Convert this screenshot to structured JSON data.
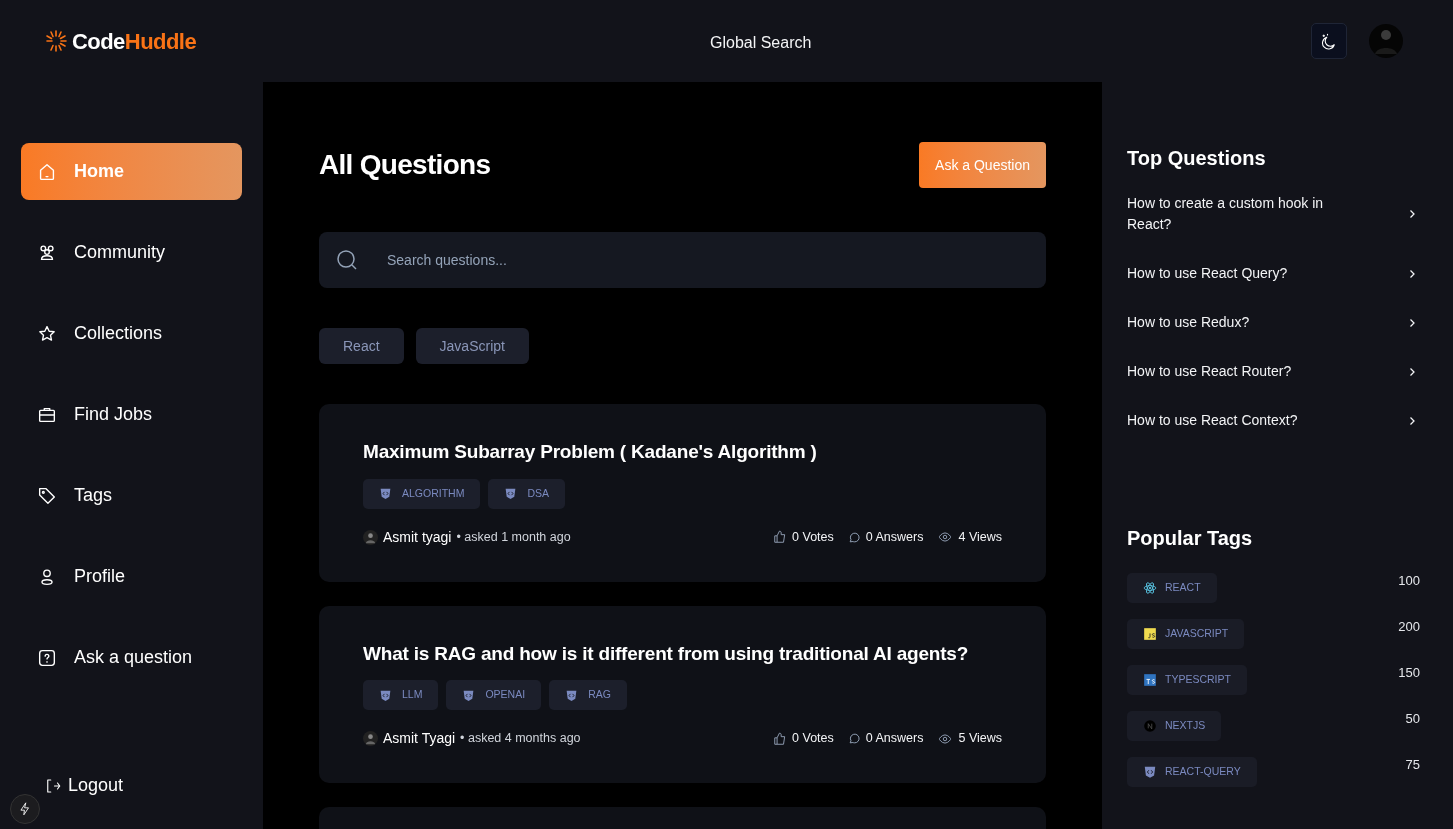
{
  "header": {
    "logo_first": "Code",
    "logo_second": "Huddle",
    "search": "Global Search"
  },
  "nav": [
    {
      "label": "Home",
      "kind": "home",
      "selected": true
    },
    {
      "label": "Community",
      "kind": "community",
      "selected": false
    },
    {
      "label": "Collections",
      "kind": "star",
      "selected": false
    },
    {
      "label": "Find Jobs",
      "kind": "briefcase",
      "selected": false
    },
    {
      "label": "Tags",
      "kind": "tag",
      "selected": false
    },
    {
      "label": "Profile",
      "kind": "user",
      "selected": false
    },
    {
      "label": "Ask a question",
      "kind": "question",
      "selected": false
    }
  ],
  "logout": "Logout",
  "main": {
    "title": "All Questions",
    "ask_button": "Ask a Question",
    "search_placeholder": "Search questions...",
    "filters": [
      "React",
      "JavaScript"
    ],
    "questions": [
      {
        "title": "Maximum Subarray Problem ( Kadane's Algorithm )",
        "tags": [
          "ALGORITHM",
          "DSA"
        ],
        "author": "Asmit tyagi",
        "asked": "• asked 1 month ago",
        "votes": "0 Votes",
        "answers": "0 Answers",
        "views": "4 Views"
      },
      {
        "title": "What is RAG and how is it different from using traditional AI agents?",
        "tags": [
          "LLM",
          "OPENAI",
          "RAG"
        ],
        "author": "Asmit Tyagi",
        "asked": "• asked 4 months ago",
        "votes": "0 Votes",
        "answers": "0 Answers",
        "views": "5 Views"
      }
    ]
  },
  "top_questions": {
    "title": "Top Questions",
    "items": [
      "How to create a custom hook in React?",
      "How to use React Query?",
      "How to use Redux?",
      "How to use React Router?",
      "How to use React Context?"
    ]
  },
  "popular_tags": {
    "title": "Popular Tags",
    "items": [
      {
        "name": "REACT",
        "kind": "react",
        "count": "100"
      },
      {
        "name": "JAVASCRIPT",
        "kind": "js",
        "count": "200"
      },
      {
        "name": "TYPESCRIPT",
        "kind": "ts",
        "count": "150"
      },
      {
        "name": "NEXTJS",
        "kind": "next",
        "count": "50"
      },
      {
        "name": "REACT-QUERY",
        "kind": "generic",
        "count": "75"
      }
    ]
  }
}
